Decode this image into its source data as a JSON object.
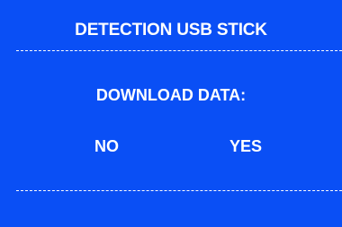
{
  "dialog": {
    "title": "DETECTION USB STICK",
    "prompt": "DOWNLOAD DATA:",
    "options": {
      "no": "NO",
      "yes": "YES"
    }
  },
  "colors": {
    "background": "#0a4ff5",
    "text": "#ffffff"
  }
}
